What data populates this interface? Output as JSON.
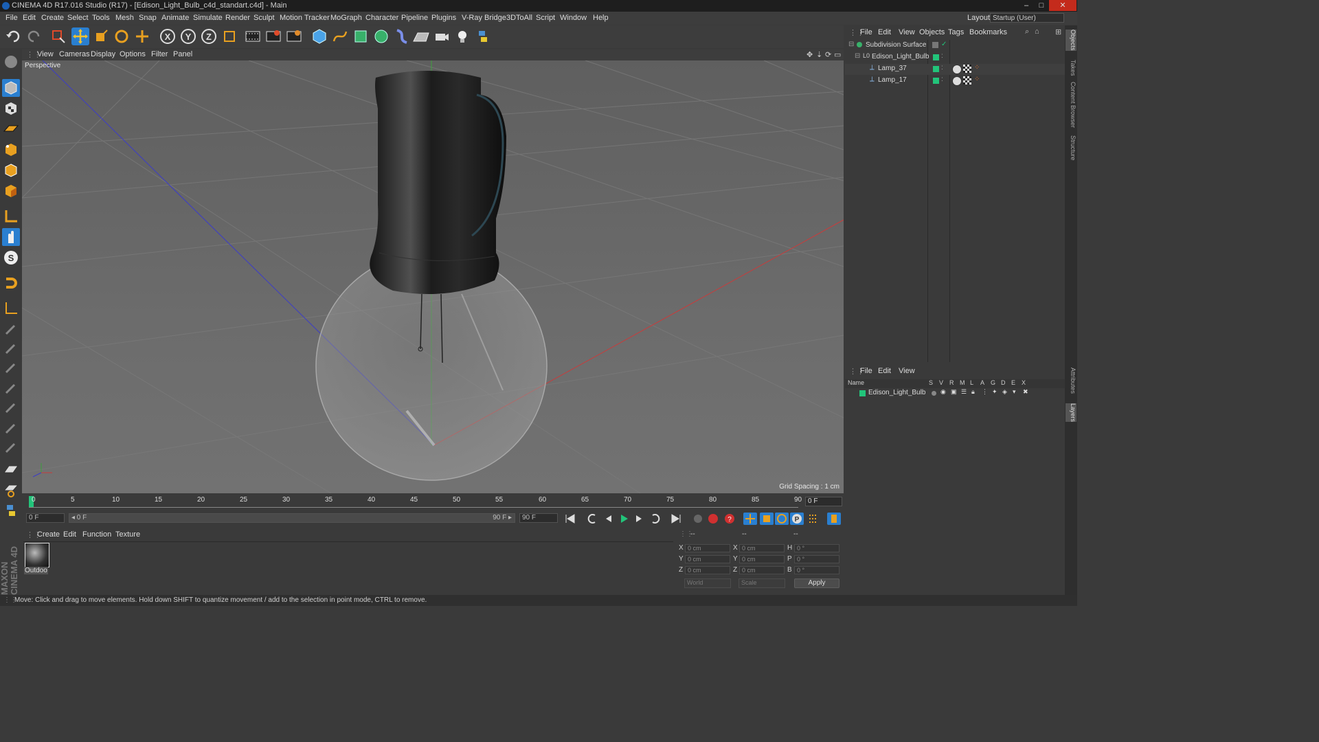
{
  "window": {
    "title": "CINEMA 4D R17.016 Studio (R17) - [Edison_Light_Bulb_c4d_standart.c4d] - Main",
    "controls": [
      "–",
      "□",
      "✕"
    ]
  },
  "menubar": {
    "items": [
      "File",
      "Edit",
      "Create",
      "Select",
      "Tools",
      "Mesh",
      "Snap",
      "Animate",
      "Simulate",
      "Render",
      "Sculpt",
      "Motion Tracker",
      "MoGraph",
      "Character",
      "Pipeline",
      "Plugins",
      "V-Ray Bridge",
      "3DToAll",
      "Script",
      "Window",
      "Help"
    ],
    "layout_label": "Layout:",
    "layout_value": "Startup (User)"
  },
  "viewport": {
    "menu": [
      "View",
      "Cameras",
      "Display",
      "Options",
      "Filter",
      "Panel"
    ],
    "camera_label": "Perspective",
    "grid_spacing": "Grid Spacing : 1 cm"
  },
  "timeline": {
    "ticks": [
      "0",
      "5",
      "10",
      "15",
      "20",
      "25",
      "30",
      "35",
      "40",
      "45",
      "50",
      "55",
      "60",
      "65",
      "70",
      "75",
      "80",
      "85",
      "90"
    ],
    "current_frame": "0 F"
  },
  "transport": {
    "start_field": "0 F",
    "range_start": "◂ 0 F",
    "range_end": "90 F ▸",
    "end_field": "90 F"
  },
  "material_manager": {
    "menu": [
      "Create",
      "Edit",
      "Function",
      "Texture"
    ],
    "material_name": "Outdoo"
  },
  "coordinates": {
    "header": [
      "--",
      "--",
      "--"
    ],
    "rows": [
      {
        "a": "X",
        "av": "0 cm",
        "b": "X",
        "bv": "0 cm",
        "c": "H",
        "cv": "0 °"
      },
      {
        "a": "Y",
        "av": "0 cm",
        "b": "Y",
        "bv": "0 cm",
        "c": "P",
        "cv": "0 °"
      },
      {
        "a": "Z",
        "av": "0 cm",
        "b": "Z",
        "bv": "0 cm",
        "c": "B",
        "cv": "0 °"
      }
    ],
    "world": "World",
    "scale": "Scale",
    "apply": "Apply"
  },
  "object_manager": {
    "menu": [
      "File",
      "Edit",
      "View",
      "Objects",
      "Tags",
      "Bookmarks"
    ],
    "objects": [
      "Subdivision Surface",
      "Edison_Light_Bulb",
      "Lamp_37",
      "Lamp_17"
    ]
  },
  "layer_manager": {
    "menu": [
      "File",
      "Edit",
      "View"
    ],
    "columns": [
      "Name",
      "S",
      "V",
      "R",
      "M",
      "L",
      "A",
      "G",
      "D",
      "E",
      "X"
    ],
    "layers": [
      "Edison_Light_Bulb"
    ]
  },
  "right_dock_tabs": [
    "Objects",
    "Takes",
    "Content Browser",
    "Structure",
    "Attributes",
    "Layers"
  ],
  "status": "Move: Click and drag to move elements. Hold down SHIFT to quantize movement / add to the selection in point mode, CTRL to remove.",
  "brand": "MAXON CINEMA 4D",
  "colors": {
    "accent": "#22c47a",
    "toolbar_blue": "#2a7fd0",
    "axis_x": "#c83c3c",
    "axis_z": "#3c3cc8",
    "axis_y": "#3cc83c"
  }
}
